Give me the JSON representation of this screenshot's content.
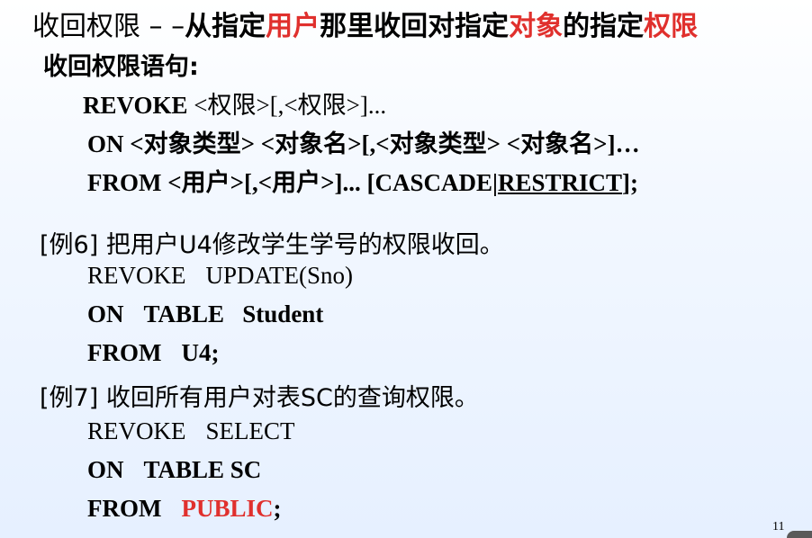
{
  "title": {
    "part1": "收回权限 – –",
    "part2": "从指定",
    "part3": "用户",
    "part4": "那里收回对指定",
    "part5": "对象",
    "part6": "的指定",
    "part7": "权限"
  },
  "subtitle": "收回权限语句:",
  "syntax": {
    "kw_revoke": "REVOKE",
    "revoke_args": "<权限>[,<权限>]...",
    "on_line": "ON <对象类型> <对象名>[,<对象类型> <对象名>]…",
    "from_prefix": "FROM <用户>[,<用户>]... [CASCADE|",
    "restrict": "RESTRICT",
    "from_suffix": "];"
  },
  "example6": {
    "label": "[例6] 把用户U4修改学生学号的权限收回。",
    "line1_kw": "REVOKE",
    "line1_rest": "UPDATE(Sno)",
    "line2_kw": "ON",
    "line2_rest": "TABLE   Student",
    "line3_kw": "FROM",
    "line3_rest": "U4;"
  },
  "example7": {
    "label": "[例7] 收回所有用户对表SC的查询权限。",
    "line1_kw": "REVOKE",
    "line1_rest": "SELECT",
    "line2_kw": "ON",
    "line2_rest": "TABLE SC",
    "line3_kw": "FROM",
    "line3_public": "PUBLIC",
    "line3_end": ";"
  },
  "page_number": "11"
}
